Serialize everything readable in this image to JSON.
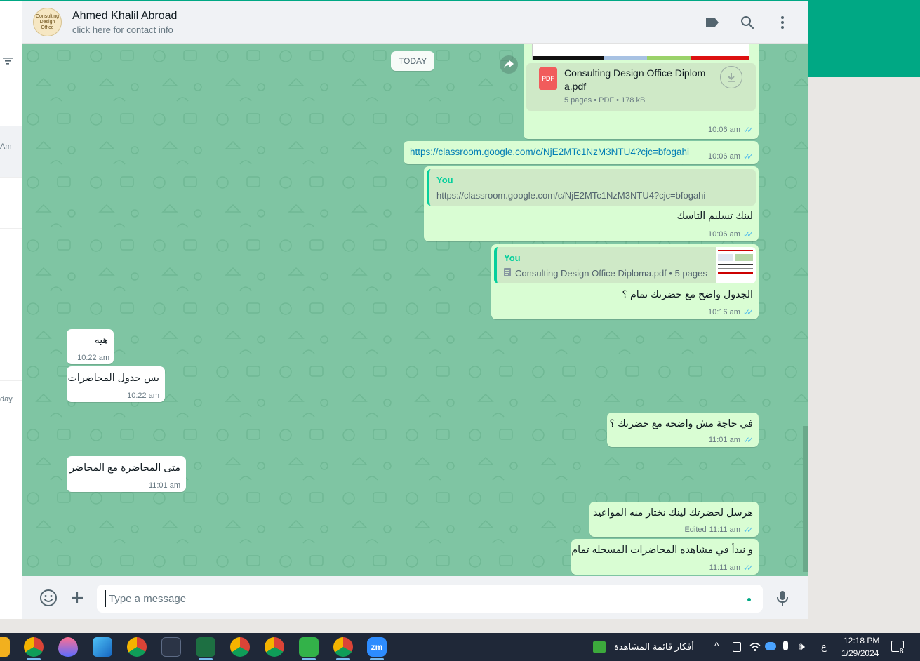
{
  "contact": {
    "name": "Ahmed Khalil Abroad",
    "subtitle": "click here for contact info",
    "avatar_text": "Consulting Design Office"
  },
  "chat": {
    "date_divider": "TODAY",
    "messages": [
      {
        "type": "document",
        "direction": "outgoing",
        "file_name_line1": "Consulting Design Office Diplom",
        "file_name_line2": "a.pdf",
        "file_meta": "5 pages • PDF • 178 kB",
        "file_badge": "PDF",
        "time": "10:06 am"
      },
      {
        "type": "link",
        "direction": "outgoing",
        "text": "https://classroom.google.com/c/NjE2MTc1NzM3NTU4?cjc=bfogahi",
        "time": "10:06 am"
      },
      {
        "type": "reply",
        "direction": "outgoing",
        "quote_author": "You",
        "quote_text": "https://classroom.google.com/c/NjE2MTc1NzM3NTU4?cjc=bfogahi",
        "text": "لينك تسليم التاسك",
        "time": "10:06 am"
      },
      {
        "type": "reply",
        "direction": "outgoing",
        "quote_author": "You",
        "quote_text": "Consulting Design Office Diploma.pdf • 5 pages",
        "text": "الجدول واضح مع حضرتك تمام ؟",
        "time": "10:16 am"
      },
      {
        "type": "text",
        "direction": "incoming",
        "text": "هيه",
        "time": "10:22 am"
      },
      {
        "type": "text",
        "direction": "incoming",
        "text": "بس جدول المحاضرات",
        "time": "10:22 am"
      },
      {
        "type": "text",
        "direction": "outgoing",
        "text": "في حاجة مش واضحه مع حضرتك ؟",
        "time": "11:01 am"
      },
      {
        "type": "text",
        "direction": "incoming",
        "text": "متى المحاضرة مع المحاضر",
        "time": "11:01 am"
      },
      {
        "type": "text",
        "direction": "outgoing",
        "text": "هرسل لحضرتك لينك نختار منه  المواعيد",
        "edited_label": "Edited",
        "time": "11:11 am"
      },
      {
        "type": "text",
        "direction": "outgoing",
        "text": "و نبدأ في مشاهده المحاضرات المسجله تمام",
        "time": "11:11 am"
      }
    ]
  },
  "compose": {
    "placeholder": "Type a message"
  },
  "sidebar_snippets": [
    "Am",
    "day"
  ],
  "taskbar": {
    "watchlist_label": "أفكار قائمة المشاهدة",
    "input_lang": "ع",
    "time": "12:18 PM",
    "date": "1/29/2024",
    "notification_count": "8",
    "apps": [
      "chrome",
      "paint-drop",
      "photos",
      "chrome-w",
      "obsidian",
      "excel",
      "chrome",
      "chrome-w",
      "camtasia",
      "chrome-profile",
      "zoom"
    ]
  },
  "colors": {
    "outgoing_bubble": "#d9fdd3",
    "incoming_bubble": "#ffffff",
    "chat_background": "#7fc5a3",
    "accent": "#00a884",
    "read_ticks": "#53bdeb",
    "link": "#027eb5"
  }
}
